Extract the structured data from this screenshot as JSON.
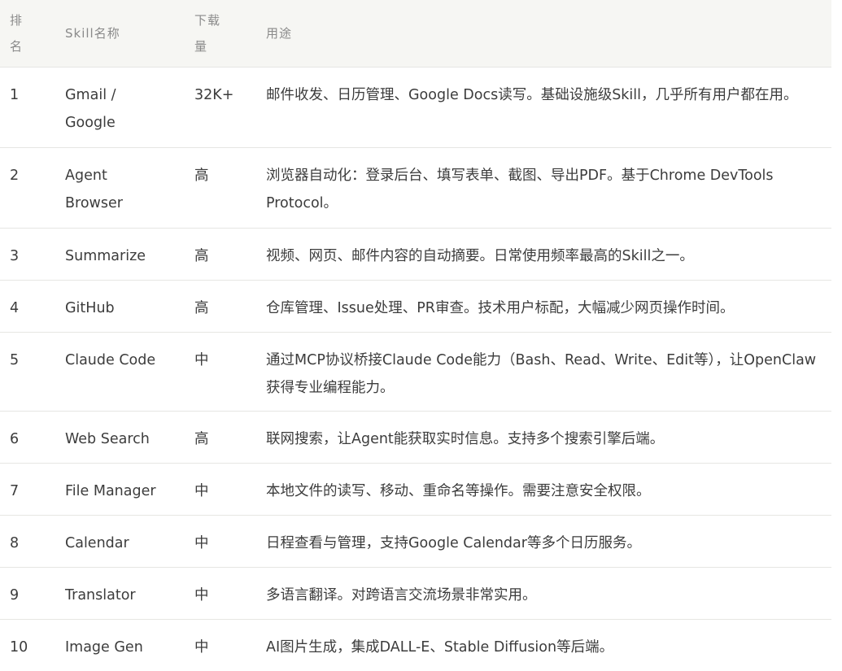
{
  "table": {
    "headers": {
      "rank": "排名",
      "name": "Skill名称",
      "downloads": "下载量",
      "usage": "用途"
    },
    "rows": [
      {
        "rank": "1",
        "name": "Gmail / Google",
        "downloads": "32K+",
        "usage": "邮件收发、日历管理、Google Docs读写。基础设施级Skill，几乎所有用户都在用。"
      },
      {
        "rank": "2",
        "name": "Agent Browser",
        "downloads": "高",
        "usage": "浏览器自动化：登录后台、填写表单、截图、导出PDF。基于Chrome DevTools Protocol。"
      },
      {
        "rank": "3",
        "name": "Summarize",
        "downloads": "高",
        "usage": "视频、网页、邮件内容的自动摘要。日常使用频率最高的Skill之一。"
      },
      {
        "rank": "4",
        "name": "GitHub",
        "downloads": "高",
        "usage": "仓库管理、Issue处理、PR审查。技术用户标配，大幅减少网页操作时间。"
      },
      {
        "rank": "5",
        "name": "Claude Code",
        "downloads": "中",
        "usage": "通过MCP协议桥接Claude Code能力（Bash、Read、Write、Edit等），让OpenClaw获得专业编程能力。"
      },
      {
        "rank": "6",
        "name": "Web Search",
        "downloads": "高",
        "usage": "联网搜索，让Agent能获取实时信息。支持多个搜索引擎后端。"
      },
      {
        "rank": "7",
        "name": "File Manager",
        "downloads": "中",
        "usage": "本地文件的读写、移动、重命名等操作。需要注意安全权限。"
      },
      {
        "rank": "8",
        "name": "Calendar",
        "downloads": "中",
        "usage": "日程查看与管理，支持Google Calendar等多个日历服务。"
      },
      {
        "rank": "9",
        "name": "Translator",
        "downloads": "中",
        "usage": "多语言翻译。对跨语言交流场景非常实用。"
      },
      {
        "rank": "10",
        "name": "Image Gen",
        "downloads": "中",
        "usage": "AI图片生成，集成DALL-E、Stable Diffusion等后端。"
      }
    ]
  }
}
